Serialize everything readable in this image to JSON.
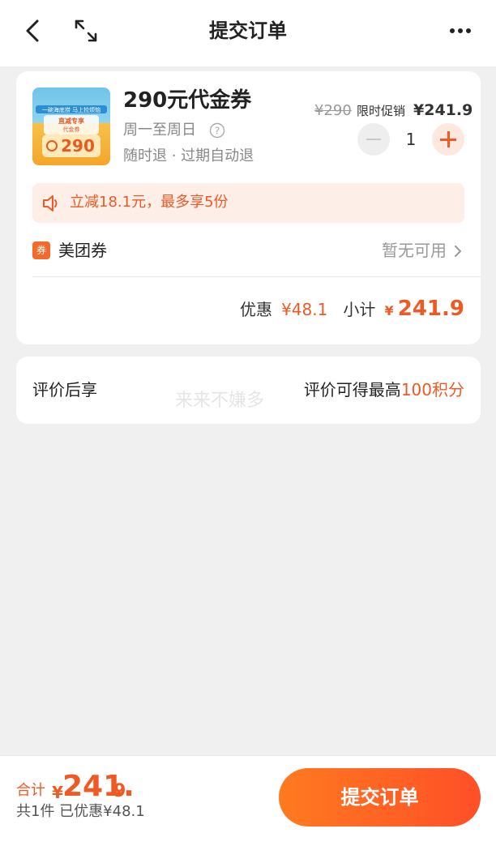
{
  "header": {
    "title": "提交订单"
  },
  "product": {
    "name": "290元代金券",
    "availability": "周一至周日",
    "refund_policy": "随时退 · 过期自动退",
    "original_price": "¥290",
    "promo_label": "限时促销",
    "promo_price": "¥241.9",
    "quantity": "1",
    "image_text": {
      "line1": "一碗海底捞 马上捡烦恼",
      "line2": "直减专享",
      "line3": "代金券",
      "line4": "290"
    }
  },
  "promo_banner": {
    "text": "立减18.1元，最多享5份"
  },
  "coupon": {
    "badge": "券",
    "label": "美团券",
    "status": "暂无可用"
  },
  "subtotal": {
    "discount_label": "优惠",
    "discount_value": "¥48.1",
    "subtotal_label": "小计",
    "currency": "¥",
    "subtotal_value": "241.9"
  },
  "review": {
    "label": "评价后享",
    "reward_prefix": "评价可得最高",
    "reward_value": "100积分",
    "watermark": "来来不嫌多"
  },
  "footer": {
    "total_label": "合计",
    "currency": "¥",
    "total_int": "241.",
    "total_dec": "9",
    "summary": "共1件  已优惠¥48.1",
    "submit_label": "提交订单"
  },
  "colors": {
    "accent": "#ef5a24",
    "button_start": "#ff7a1f",
    "button_end": "#ff4f28"
  }
}
